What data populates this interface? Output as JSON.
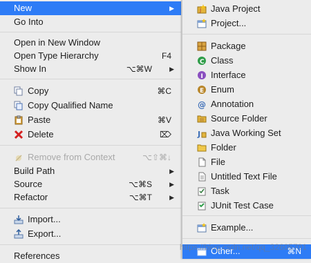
{
  "main_menu": {
    "new": "New",
    "go_into": "Go Into",
    "open_new_window": "Open in New Window",
    "open_type_hierarchy": {
      "label": "Open Type Hierarchy",
      "shortcut": "F4"
    },
    "show_in": {
      "label": "Show In",
      "shortcut": "⌥⌘W"
    },
    "copy": {
      "label": "Copy",
      "shortcut": "⌘C"
    },
    "copy_qualified": "Copy Qualified Name",
    "paste": {
      "label": "Paste",
      "shortcut": "⌘V"
    },
    "delete": {
      "label": "Delete",
      "shortcut": "⌦"
    },
    "remove_context": {
      "label": "Remove from Context",
      "shortcut": "⌥⇧⌘↓"
    },
    "build_path": "Build Path",
    "source": {
      "label": "Source",
      "shortcut": "⌥⌘S"
    },
    "refactor": {
      "label": "Refactor",
      "shortcut": "⌥⌘T"
    },
    "import": "Import...",
    "export": "Export...",
    "references": "References"
  },
  "sub_menu": {
    "java_project": "Java Project",
    "project": "Project...",
    "package": "Package",
    "class": "Class",
    "interface": "Interface",
    "enum": "Enum",
    "annotation": "Annotation",
    "source_folder": "Source Folder",
    "java_working_set": "Java Working Set",
    "folder": "Folder",
    "file": "File",
    "untitled_text_file": "Untitled Text File",
    "task": "Task",
    "junit_test_case": "JUnit Test Case",
    "example": "Example...",
    "other": {
      "label": "Other...",
      "shortcut": "⌘N"
    }
  },
  "watermark": "https://blog.csdn.net/qq_32605701",
  "colors": {
    "selection": "#2e7cf6",
    "menu_bg": "#ececec"
  }
}
